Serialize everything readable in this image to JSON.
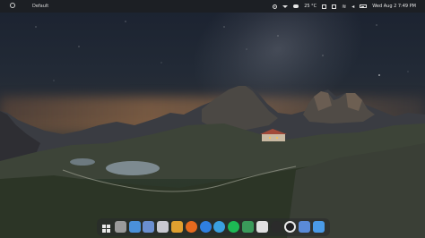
{
  "topbar": {
    "workspace_label": "Default",
    "weather": "25 °C",
    "datetime": "Wed Aug 2  7:49 PM"
  },
  "dock": {
    "apps": [
      {
        "name": "app-launcher",
        "icon": "grid-icon",
        "color": "#e8e8e8"
      },
      {
        "name": "settings",
        "icon": "gear-icon",
        "color": "#9a9a9a"
      },
      {
        "name": "files",
        "icon": "folder-icon",
        "color": "#4a90d9"
      },
      {
        "name": "mail",
        "icon": "mail-icon",
        "color": "#6a8fd0"
      },
      {
        "name": "notes",
        "icon": "document-icon",
        "color": "#c8c8d0"
      },
      {
        "name": "layers",
        "icon": "layers-icon",
        "color": "#e0a030"
      },
      {
        "name": "firefox",
        "icon": "firefox-icon",
        "color": "#e66a1e"
      },
      {
        "name": "chat",
        "icon": "chat-icon",
        "color": "#2f7fe0"
      },
      {
        "name": "telegram",
        "icon": "telegram-icon",
        "color": "#3aa0e0"
      },
      {
        "name": "spotify",
        "icon": "spotify-icon",
        "color": "#1db954"
      },
      {
        "name": "chart",
        "icon": "chart-icon",
        "color": "#3a9a5a"
      },
      {
        "name": "ghost",
        "icon": "ghost-icon",
        "color": "#e0e0e0"
      },
      {
        "name": "media",
        "icon": "disc-icon",
        "color": "#2b2b2b"
      },
      {
        "name": "record",
        "icon": "record-icon",
        "color": "#e8e8e8"
      },
      {
        "name": "photos",
        "icon": "image-icon",
        "color": "#5a8ad8"
      },
      {
        "name": "store",
        "icon": "store-icon",
        "color": "#4a9ae8"
      }
    ]
  }
}
